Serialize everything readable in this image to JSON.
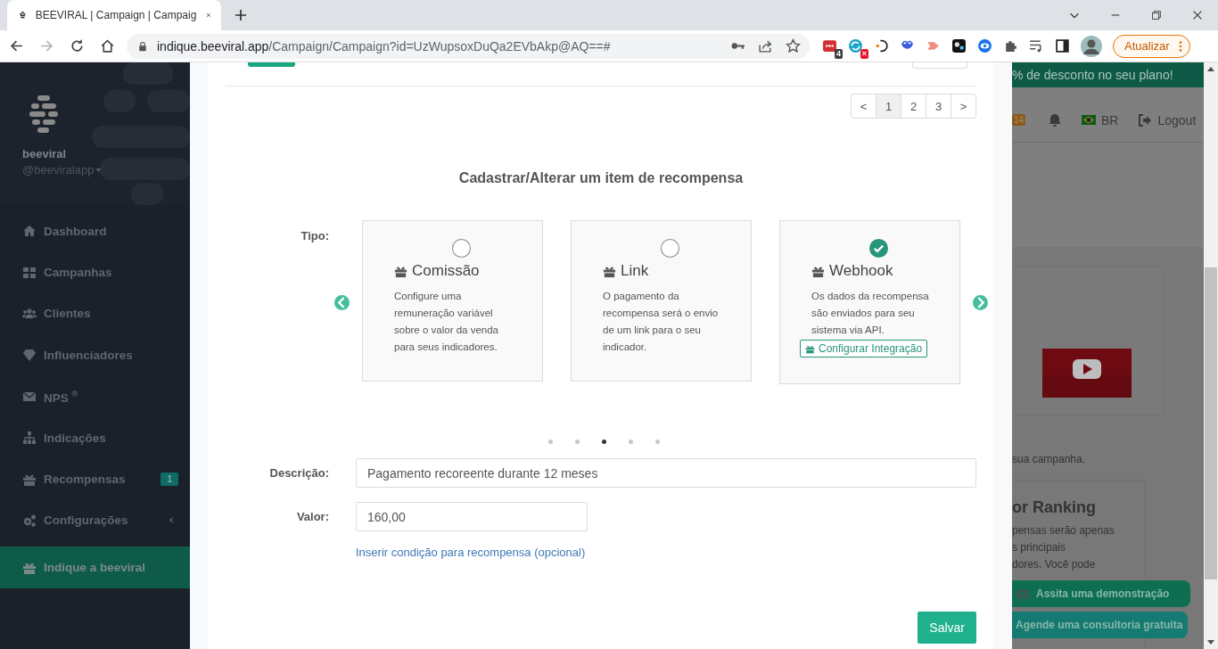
{
  "browser": {
    "tab_title": "BEEVIRAL | Campaign | Campaig",
    "url_host": "indique.beeviral.app",
    "url_path": "/Campaign/Campaign?id=UzWupsoxDuQa2EVbAkp@AQ==#",
    "extension_badges": [
      {
        "label": "4",
        "color": "#3c4043"
      },
      {
        "label": "×",
        "color": "#e8192c"
      }
    ],
    "update_button": "Atualizar"
  },
  "sidebar": {
    "brand": "beeviral",
    "handle": "@beeviralapp",
    "items": [
      {
        "label": "Dashboard",
        "selected": false
      },
      {
        "label": "Campanhas",
        "selected": false
      },
      {
        "label": "Clientes",
        "selected": false
      },
      {
        "label": "Influenciadores",
        "selected": false
      },
      {
        "label": "NPS $^{®}$",
        "selected": false
      },
      {
        "label": "Indicações",
        "selected": false
      },
      {
        "label": "Recompensas",
        "badge": "1",
        "selected": false
      },
      {
        "label": "Configurações",
        "expanded": false,
        "selected": false
      },
      {
        "label": "Indique a beeviral",
        "selected": true
      }
    ]
  },
  "modal": {
    "top_toggle": {
      "on": true
    },
    "pagination": {
      "previous": "<",
      "next": ">",
      "pages": [
        {
          "label": "1",
          "selected": true
        },
        {
          "label": "2",
          "selected": false
        },
        {
          "label": "3",
          "selected": false
        }
      ]
    },
    "title": "Cadastrar/Alterar um item de recompensa",
    "type_label": "Tipo:",
    "options": [
      {
        "title": "Comissão",
        "description": "Configure uma remuneração variável sobre o valor da venda para seus indicadores.",
        "selected": false
      },
      {
        "title": "Link",
        "description": "O pagamento da recompensa será o envio de um link para o seu indicador.",
        "selected": false
      },
      {
        "title": "Webhook",
        "description": "Os dados da recompensa são enviados para seu sistema via API.",
        "action": "Configurar Integração",
        "selected": true
      }
    ],
    "carousel_dots": [
      {
        "selected": false
      },
      {
        "selected": false
      },
      {
        "selected": true
      },
      {
        "selected": false
      },
      {
        "selected": false
      }
    ],
    "fields": [
      {
        "label": "Descrição:",
        "value": "Pagamento recoreente durante 12 meses",
        "kind": "wide"
      },
      {
        "label": "Valor:",
        "value": "160,00",
        "kind": "narrow"
      }
    ],
    "condition_link": "Inserir condição para recompensa (opcional)",
    "save_button": "Salvar"
  },
  "background_page": {
    "banner": "% de desconto no seu plano!",
    "message_badge": "14",
    "language": "BR",
    "logout": "Logout",
    "caption": "sua campanha.",
    "ranking_title": "or Ranking",
    "ranking_lines": [
      "pensas serão apenas",
      "s principais",
      "dores. Você pode"
    ],
    "floating_buttons": [
      "Assita uma demonstração",
      "Agende uma consultoria gratuita"
    ]
  }
}
